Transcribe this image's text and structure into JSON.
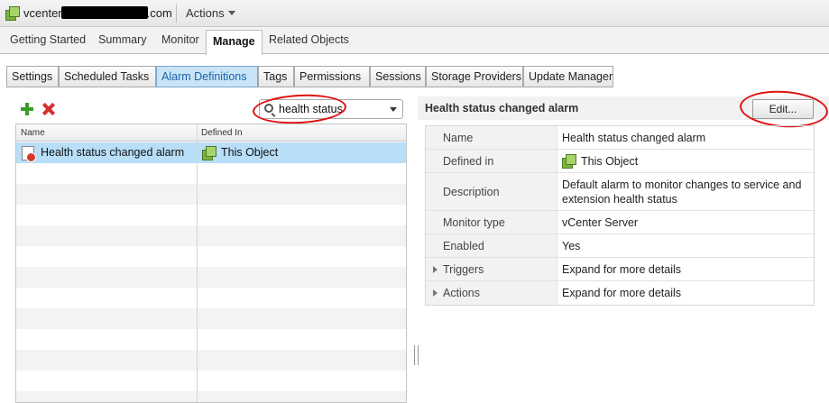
{
  "titlebar": {
    "host_prefix": "vcenter",
    "host_suffix": ".com",
    "actions_label": "Actions"
  },
  "main_tabs": [
    {
      "label": "Getting Started"
    },
    {
      "label": "Summary"
    },
    {
      "label": "Monitor"
    },
    {
      "label": "Manage",
      "active": true
    },
    {
      "label": "Related Objects"
    }
  ],
  "sub_tabs": [
    {
      "label": "Settings"
    },
    {
      "label": "Scheduled Tasks"
    },
    {
      "label": "Alarm Definitions",
      "active": true
    },
    {
      "label": "Tags"
    },
    {
      "label": "Permissions"
    },
    {
      "label": "Sessions"
    },
    {
      "label": "Storage Providers"
    },
    {
      "label": "Update Manager"
    }
  ],
  "filter": {
    "value": "health status"
  },
  "alarm_grid": {
    "columns": [
      "Name",
      "Defined In"
    ],
    "rows": [
      {
        "name": "Health status changed alarm",
        "defined_in": "This Object",
        "selected": true
      }
    ]
  },
  "details": {
    "title": "Health status changed alarm",
    "edit_label": "Edit...",
    "properties": [
      {
        "key": "Name",
        "value": "Health status changed alarm"
      },
      {
        "key": "Defined in",
        "value": "This Object",
        "icon": "vcenter-icon"
      },
      {
        "key": "Description",
        "value": "Default alarm to monitor changes to service and extension health status"
      },
      {
        "key": "Monitor type",
        "value": "vCenter Server"
      },
      {
        "key": "Enabled",
        "value": "Yes"
      },
      {
        "key": "Triggers",
        "value": "Expand for more details",
        "expandable": true
      },
      {
        "key": "Actions",
        "value": "Expand for more details",
        "expandable": true
      }
    ]
  },
  "colors": {
    "selected_row": "#b8def8",
    "active_subtab": "#c9e4f7",
    "annotation": "#e01010",
    "add": "#3b9c2c",
    "delete": "#d32f2f"
  }
}
